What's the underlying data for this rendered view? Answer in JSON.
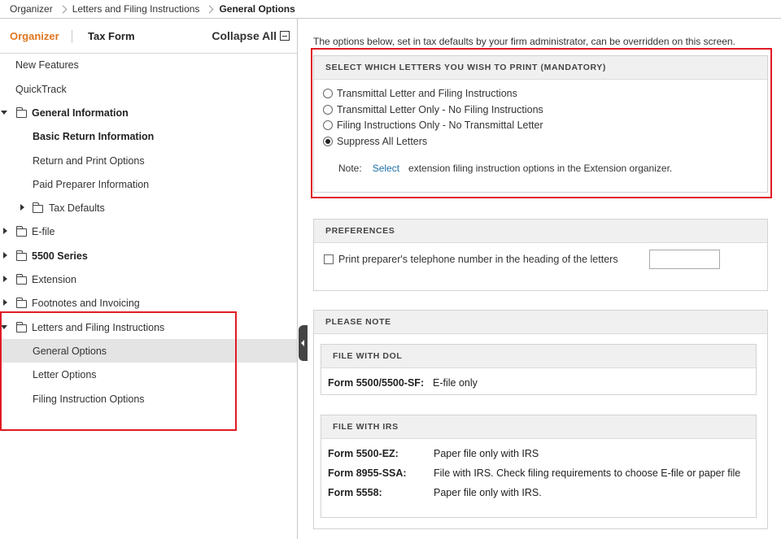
{
  "breadcrumb": [
    "Organizer",
    "Letters and Filing Instructions",
    "General Options"
  ],
  "sidebar": {
    "tab_organizer": "Organizer",
    "tab_taxform": "Tax Form",
    "collapse_all": "Collapse All",
    "items": [
      {
        "label": "New Features"
      },
      {
        "label": "QuickTrack"
      },
      {
        "label": "General Information"
      },
      {
        "label": "Basic Return Information"
      },
      {
        "label": "Return and Print Options"
      },
      {
        "label": "Paid Preparer Information"
      },
      {
        "label": "Tax Defaults"
      },
      {
        "label": "E-file"
      },
      {
        "label": "5500 Series"
      },
      {
        "label": "Extension"
      },
      {
        "label": "Footnotes and Invoicing"
      },
      {
        "label": "Letters and Filing Instructions"
      },
      {
        "label": "General Options"
      },
      {
        "label": "Letter Options"
      },
      {
        "label": "Filing Instruction Options"
      }
    ]
  },
  "main": {
    "intro": "The options below, set in tax defaults by your firm administrator, can be overridden on this screen.",
    "letters": {
      "header": "SELECT WHICH LETTERS YOU WISH TO PRINT (MANDATORY)",
      "options": [
        "Transmittal Letter and Filing Instructions",
        "Transmittal Letter Only - No Filing Instructions",
        "Filing Instructions Only - No Transmittal Letter",
        "Suppress All Letters"
      ],
      "selected": "Suppress All Letters",
      "note_label": "Note:",
      "note_link": "Select",
      "note_text": "extension filing instruction options in the Extension organizer."
    },
    "preferences": {
      "header": "PREFERENCES",
      "checkbox_label": "Print preparer's telephone number in the heading of the letters",
      "checked": false,
      "phone_value": ""
    },
    "please_note": {
      "header": "PLEASE NOTE",
      "dol": {
        "header": "FILE WITH DOL",
        "rows": [
          {
            "form": "Form 5500/5500-SF:",
            "value": "E-file only"
          }
        ]
      },
      "irs": {
        "header": "FILE WITH IRS",
        "rows": [
          {
            "form": "Form 5500-EZ:",
            "value": "Paper file only with IRS"
          },
          {
            "form": "Form 8955-SSA:",
            "value": "File with IRS. Check filing requirements to choose E-file or paper file"
          },
          {
            "form": "Form 5558:",
            "value": "Paper file only with IRS."
          }
        ]
      }
    }
  },
  "colors": {
    "accent": "#e0761f",
    "link": "#1a6fa8",
    "highlight": "#e01b24"
  }
}
